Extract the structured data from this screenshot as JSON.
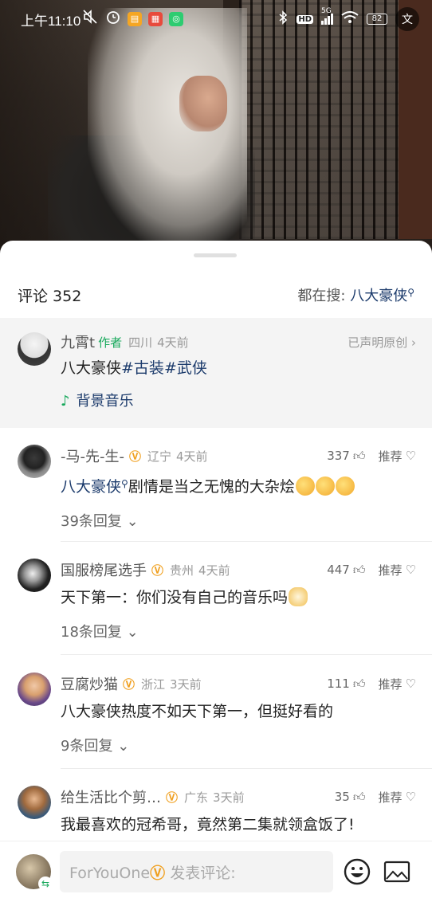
{
  "status_bar": {
    "time": "上午11:10",
    "network": "5G",
    "hd": "HD",
    "battery": "82",
    "fullscreen_label": "文"
  },
  "sheet": {
    "title": "评论 352",
    "search_prefix": "都在搜:",
    "search_keyword": "八大豪侠"
  },
  "author_post": {
    "name": "九霄t",
    "badge": "作者",
    "location": "四川",
    "time": "4天前",
    "declared": "已声明原创",
    "text_plain": "八大豪侠",
    "tags": [
      "#古装",
      "#武侠"
    ],
    "music_label": "背景音乐"
  },
  "comments": [
    {
      "name": "-马-先-生-",
      "location": "辽宁",
      "time": "4天前",
      "likes": "337",
      "recommend": "推荐",
      "keyword": "八大豪侠",
      "text": "剧情是当之无愧的大杂烩",
      "replies": "39条回复"
    },
    {
      "name": "国服榜尾选手",
      "location": "贵州",
      "time": "4天前",
      "likes": "447",
      "recommend": "推荐",
      "text": "天下第一：你们没有自己的音乐吗",
      "replies": "18条回复"
    },
    {
      "name": "豆腐炒猫",
      "location": "浙江",
      "time": "3天前",
      "likes": "111",
      "recommend": "推荐",
      "text": "八大豪侠热度不如天下第一，但挺好看的",
      "replies": "9条回复"
    },
    {
      "name": "给生活比个剪…",
      "location": "广东",
      "time": "3天前",
      "likes": "35",
      "recommend": "推荐",
      "text": "我最喜欢的冠希哥，竟然第二集就领盒饭了!"
    }
  ],
  "bottom_bar": {
    "username": "ForYouOne",
    "placeholder": "发表评论:"
  },
  "colors": {
    "keyword_blue": "#1b3a6b",
    "author_green": "#17a85b",
    "vip_gold": "#f0a020"
  }
}
